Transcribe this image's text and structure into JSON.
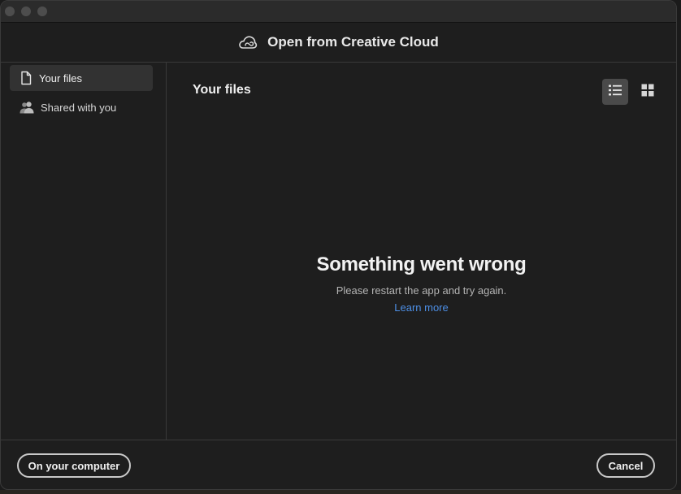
{
  "dialog": {
    "title": "Open from Creative Cloud",
    "icon": "creative-cloud-icon"
  },
  "sidebar": {
    "items": [
      {
        "label": "Your files",
        "icon": "file-icon",
        "active": true
      },
      {
        "label": "Shared with you",
        "icon": "people-icon",
        "active": false
      }
    ]
  },
  "main": {
    "title": "Your files",
    "view_modes": [
      {
        "name": "list-view",
        "icon": "list-icon",
        "active": true
      },
      {
        "name": "grid-view",
        "icon": "grid-icon",
        "active": false
      }
    ]
  },
  "error": {
    "title": "Something went wrong",
    "message": "Please restart the app and try again.",
    "link": "Learn more"
  },
  "footer": {
    "left_button": "On your computer",
    "right_button": "Cancel"
  },
  "colors": {
    "background": "#1e1e1e",
    "link": "#4d8fe6",
    "active_item": "#323232"
  }
}
